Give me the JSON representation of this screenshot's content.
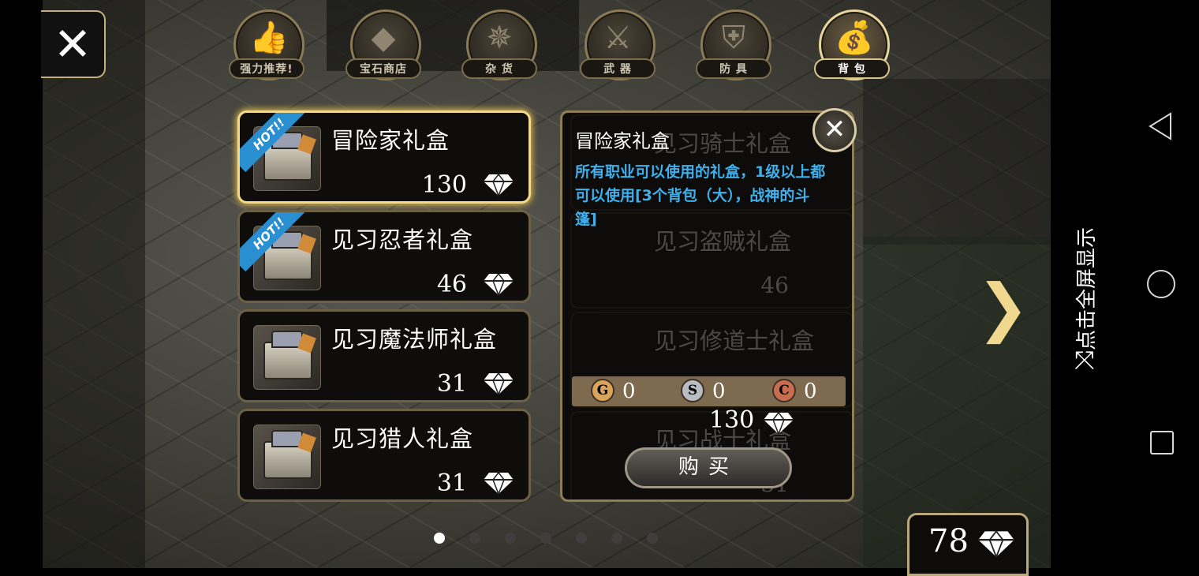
{
  "tabs": [
    {
      "label": "强力推荐!",
      "icon": "thumbs-up-icon",
      "active": false
    },
    {
      "label": "宝石商店",
      "icon": "gem-icon",
      "active": false
    },
    {
      "label": "杂 货",
      "icon": "compass-icon",
      "active": false
    },
    {
      "label": "武 器",
      "icon": "sword-icon",
      "active": false
    },
    {
      "label": "防 具",
      "icon": "shield-icon",
      "active": false
    },
    {
      "label": "背 包",
      "icon": "bag-icon",
      "active": true
    }
  ],
  "items": [
    {
      "name": "冒险家礼盒",
      "price": "130",
      "hot": true,
      "selected": true
    },
    {
      "name": "见习忍者礼盒",
      "price": "46",
      "hot": true,
      "selected": false
    },
    {
      "name": "见习魔法师礼盒",
      "price": "31",
      "hot": false,
      "selected": false
    },
    {
      "name": "见习猎人礼盒",
      "price": "31",
      "hot": false,
      "selected": false
    }
  ],
  "hot_label": "HOT!!",
  "background_items": [
    {
      "name": "见习骑士礼盒",
      "price": ""
    },
    {
      "name": "见习盗贼礼盒",
      "price": "46"
    },
    {
      "name": "见习修道士礼盒",
      "price": ""
    },
    {
      "name": "见习战士礼盒",
      "price": "31"
    }
  ],
  "detail": {
    "title": "冒险家礼盒",
    "description": "所有职业可以使用的礼盒，1级以上都可以使用[3个背包（大），战神的斗篷]",
    "coins": [
      {
        "symbol": "G",
        "value": "0",
        "color": "#d9a35a"
      },
      {
        "symbol": "S",
        "value": "0",
        "color": "#b9bcc2"
      },
      {
        "symbol": "C",
        "value": "0",
        "color": "#c86e4e"
      }
    ],
    "price": "130",
    "buy_label": "购买"
  },
  "pager": {
    "total": 7,
    "current": 0
  },
  "gems": "78",
  "fullscreen_hint": "点击全屏显示",
  "colors": {
    "accent_gold": "#f3d98a",
    "desc_blue": "#3fb0ec",
    "hot_blue": "#2a8fd0"
  }
}
